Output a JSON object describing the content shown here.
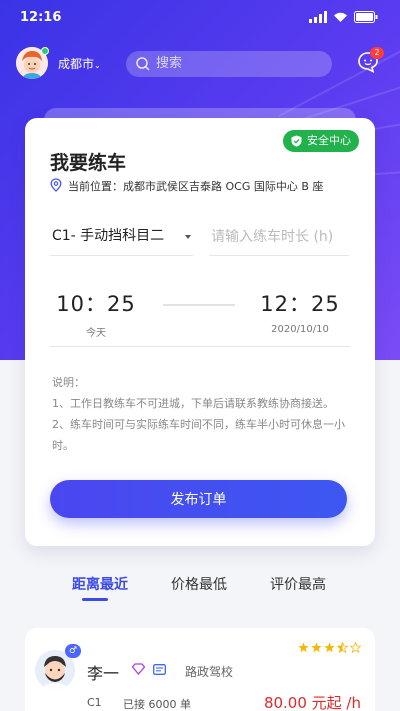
{
  "statusbar": {
    "time": "12:16"
  },
  "header": {
    "city": "成都市",
    "search_placeholder": "搜索",
    "message_count": "2"
  },
  "card": {
    "safety_label": "安全中心",
    "title": "我要练车",
    "location": "当前位置：成都市武侯区吉泰路 OCG 国际中心 B 座",
    "subject": "C1- 手动挡科目二",
    "duration_placeholder": "请输入练车时长 (h)",
    "start_time": "10：25",
    "start_date": "今天",
    "end_time": "12：25",
    "end_date": "2020/10/10",
    "notes_title": "说明：",
    "note_1": "1、工作日教练车不可进城，下单后请联系教练协商接送。",
    "note_2": "2、练车时间可与实际练车时间不同，练车半小时可休息一小时。",
    "publish_label": "发布订单"
  },
  "tabs": [
    {
      "label": "距离最近"
    },
    {
      "label": "价格最低"
    },
    {
      "label": "评价最高"
    }
  ],
  "coach": {
    "name": "李一",
    "school": "路政驾校",
    "license": "C1",
    "orders": "已接 6000 单",
    "price": "80.00 元起 /h",
    "rating": 3.5
  },
  "colors": {
    "primary": "#3b4be8",
    "safety": "#21b24b",
    "price": "#e02a2a",
    "badge": "#ff3b3b"
  }
}
